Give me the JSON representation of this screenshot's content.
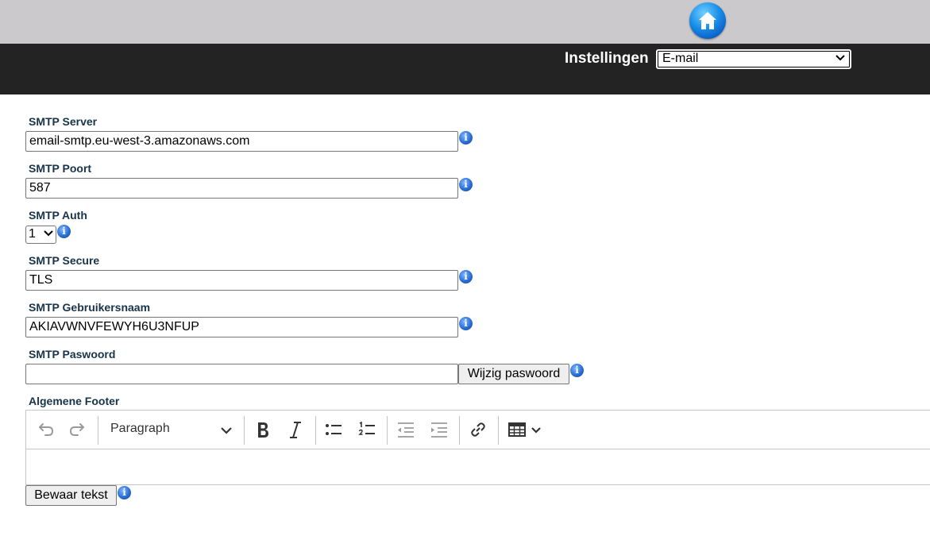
{
  "header": {
    "home_icon": "home-icon",
    "title": "Instellingen",
    "category_select": "E-mail"
  },
  "form": {
    "smtp_server": {
      "label": "SMTP Server",
      "value": "email-smtp.eu-west-3.amazonaws.com"
    },
    "smtp_port": {
      "label": "SMTP Poort",
      "value": "587"
    },
    "smtp_auth": {
      "label": "SMTP Auth",
      "value": "1"
    },
    "smtp_secure": {
      "label": "SMTP Secure",
      "value": "TLS"
    },
    "smtp_user": {
      "label": "SMTP Gebruikersnaam",
      "value": "AKIAVWNVFEWYH6U3NFUP"
    },
    "smtp_password": {
      "label": "SMTP Paswoord",
      "value": "",
      "change_button": "Wijzig paswoord"
    },
    "footer": {
      "label": "Algemene Footer",
      "paragraph_style": "Paragraph",
      "content": ""
    },
    "save_button": "Bewaar tekst"
  },
  "info_icon_glyph": "i"
}
